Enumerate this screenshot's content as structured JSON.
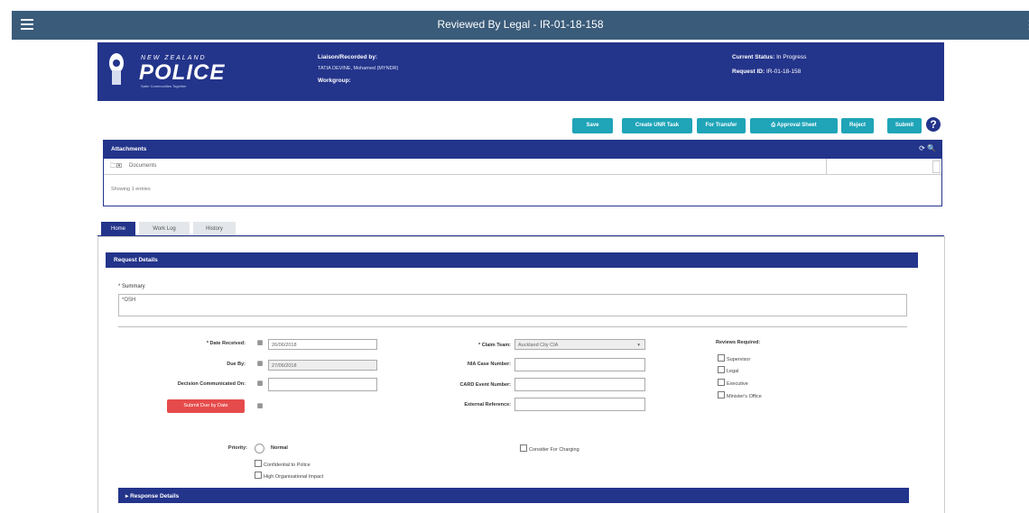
{
  "header": {
    "title": "Reviewed By Legal - IR-01-18-158"
  },
  "banner": {
    "logo_top": "NEW ZEALAND",
    "logo_main": "POLICE",
    "logo_tag": "Safer Communities Together",
    "liaison_label": "Liaison/Recorded by:",
    "liaison_value": "TATIA DEVINE, Mohamed (MYNDR)",
    "workgroup_label": "Workgroup:",
    "status_label": "Current Status:",
    "status_value": "In Progress",
    "request_label": "Request ID:",
    "request_value": "IR-01-18-158"
  },
  "toolbar": {
    "save": "Save",
    "create_unit": "Create UNR Task",
    "for_transfer": "For Transfer",
    "print_icon": "print-icon",
    "approval": "Approval Sheet",
    "reject": "Reject",
    "submit": "Submit",
    "help": "?"
  },
  "attachments": {
    "title": "Attachments",
    "icons": "⟳ 🔍",
    "folder": "Documents",
    "footer": "Showing 1 entries"
  },
  "tabs": [
    {
      "label": "Home"
    },
    {
      "label": "Work Log"
    },
    {
      "label": "History"
    }
  ],
  "request_details": {
    "title": "Request Details",
    "summary_label": "* Summary",
    "summary_value": "*OSH",
    "date_received_label": "* Date Received:",
    "date_received_value": "26/06/2018",
    "due_by_label": "Due By:",
    "due_by_value": "27/06/2018",
    "decision_label": "Decision Communicated On:",
    "decision_value": "",
    "submit_due_label": "Submit Due by Date",
    "claim_team_label": "* Claim Team:",
    "claim_team_value": "Auckland City CIA",
    "nia_label": "NIA Case Number:",
    "cars_label": "CARD Event Number:",
    "external_label": "External Reference:",
    "reviews_label": "Reviews Required:",
    "reviews": [
      "Supervisor",
      "Legal",
      "Executive",
      "Minister's Office"
    ],
    "priority_label": "Priority:",
    "priority_value": "Normal",
    "consider_label": "Consider For Charging",
    "confidential_label": "Confidential to Police",
    "high_org_label": "High Organisational Impact"
  },
  "response_details": {
    "title": "▸ Response Details"
  }
}
